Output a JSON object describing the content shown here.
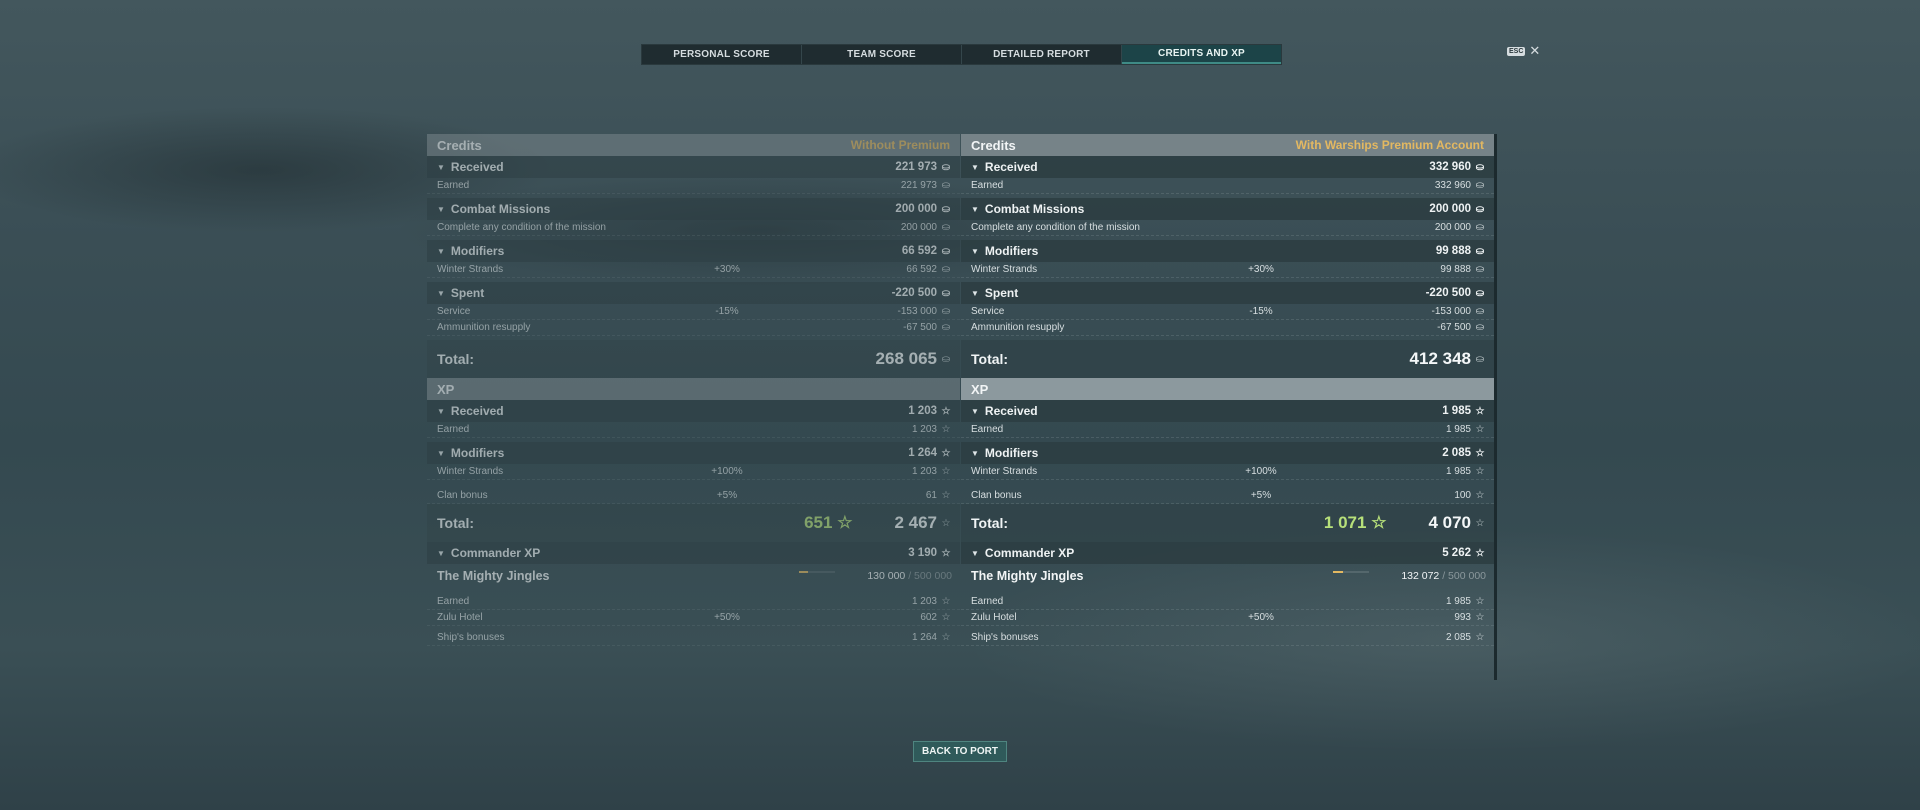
{
  "tabs": [
    {
      "label": "PERSONAL SCORE"
    },
    {
      "label": "TEAM SCORE"
    },
    {
      "label": "DETAILED REPORT"
    },
    {
      "label": "CREDITS AND XP"
    }
  ],
  "esc": {
    "key": "ESC",
    "close": "✕"
  },
  "back_button": "BACK TO PORT",
  "icons": {
    "credit": "⛀",
    "xp": "☆"
  },
  "left": {
    "credits_title": "Credits",
    "premium_tag": "Without Premium",
    "received": {
      "label": "Received",
      "value": "221 973"
    },
    "earned": {
      "label": "Earned",
      "value": "221 973"
    },
    "combat_missions": {
      "label": "Combat Missions",
      "value": "200 000"
    },
    "mission_row": {
      "label": "Complete any condition of the mission",
      "value": "200 000"
    },
    "modifiers": {
      "label": "Modifiers",
      "value": "66 592"
    },
    "winter": {
      "label": "Winter Strands",
      "pct": "+30%",
      "value": "66 592"
    },
    "spent": {
      "label": "Spent",
      "value": "-220 500"
    },
    "service": {
      "label": "Service",
      "pct": "-15%",
      "value": "-153 000"
    },
    "ammo": {
      "label": "Ammunition resupply",
      "value": "-67 500"
    },
    "credits_total": {
      "label": "Total:",
      "value": "268 065"
    },
    "xp_title": "XP",
    "xp_received": {
      "label": "Received",
      "value": "1 203"
    },
    "xp_earned": {
      "label": "Earned",
      "value": "1 203"
    },
    "xp_modifiers": {
      "label": "Modifiers",
      "value": "1 264"
    },
    "xp_winter": {
      "label": "Winter Strands",
      "pct": "+100%",
      "value": "1 203"
    },
    "xp_clan": {
      "label": "Clan bonus",
      "pct": "+5%",
      "value": "61"
    },
    "xp_total": {
      "label": "Total:",
      "free": "651",
      "value": "2 467"
    },
    "cmdr": {
      "label": "Commander XP",
      "value": "3 190"
    },
    "cmdr_name": {
      "label": "The Mighty Jingles",
      "current": "130 000",
      "max": "/ 500 000",
      "progress": 0.26
    },
    "cmdr_earned": {
      "label": "Earned",
      "value": "1 203"
    },
    "cmdr_zulu": {
      "label": "Zulu Hotel",
      "pct": "+50%",
      "value": "602"
    },
    "cmdr_bonus": {
      "label": "Ship's bonuses",
      "value": "1 264"
    }
  },
  "right": {
    "credits_title": "Credits",
    "premium_tag": "With Warships Premium Account",
    "received": {
      "label": "Received",
      "value": "332 960"
    },
    "earned": {
      "label": "Earned",
      "value": "332 960"
    },
    "combat_missions": {
      "label": "Combat Missions",
      "value": "200 000"
    },
    "mission_row": {
      "label": "Complete any condition of the mission",
      "value": "200 000"
    },
    "modifiers": {
      "label": "Modifiers",
      "value": "99 888"
    },
    "winter": {
      "label": "Winter Strands",
      "pct": "+30%",
      "value": "99 888"
    },
    "spent": {
      "label": "Spent",
      "value": "-220 500"
    },
    "service": {
      "label": "Service",
      "pct": "-15%",
      "value": "-153 000"
    },
    "ammo": {
      "label": "Ammunition resupply",
      "value": "-67 500"
    },
    "credits_total": {
      "label": "Total:",
      "value": "412 348"
    },
    "xp_title": "XP",
    "xp_received": {
      "label": "Received",
      "value": "1 985"
    },
    "xp_earned": {
      "label": "Earned",
      "value": "1 985"
    },
    "xp_modifiers": {
      "label": "Modifiers",
      "value": "2 085"
    },
    "xp_winter": {
      "label": "Winter Strands",
      "pct": "+100%",
      "value": "1 985"
    },
    "xp_clan": {
      "label": "Clan bonus",
      "pct": "+5%",
      "value": "100"
    },
    "xp_total": {
      "label": "Total:",
      "free": "1 071",
      "value": "4 070"
    },
    "cmdr": {
      "label": "Commander XP",
      "value": "5 262"
    },
    "cmdr_name": {
      "label": "The Mighty Jingles",
      "current": "132 072",
      "max": "/ 500 000",
      "progress": 0.264
    },
    "cmdr_earned": {
      "label": "Earned",
      "value": "1 985"
    },
    "cmdr_zulu": {
      "label": "Zulu Hotel",
      "pct": "+50%",
      "value": "993"
    },
    "cmdr_bonus": {
      "label": "Ship's bonuses",
      "value": "2 085"
    }
  }
}
